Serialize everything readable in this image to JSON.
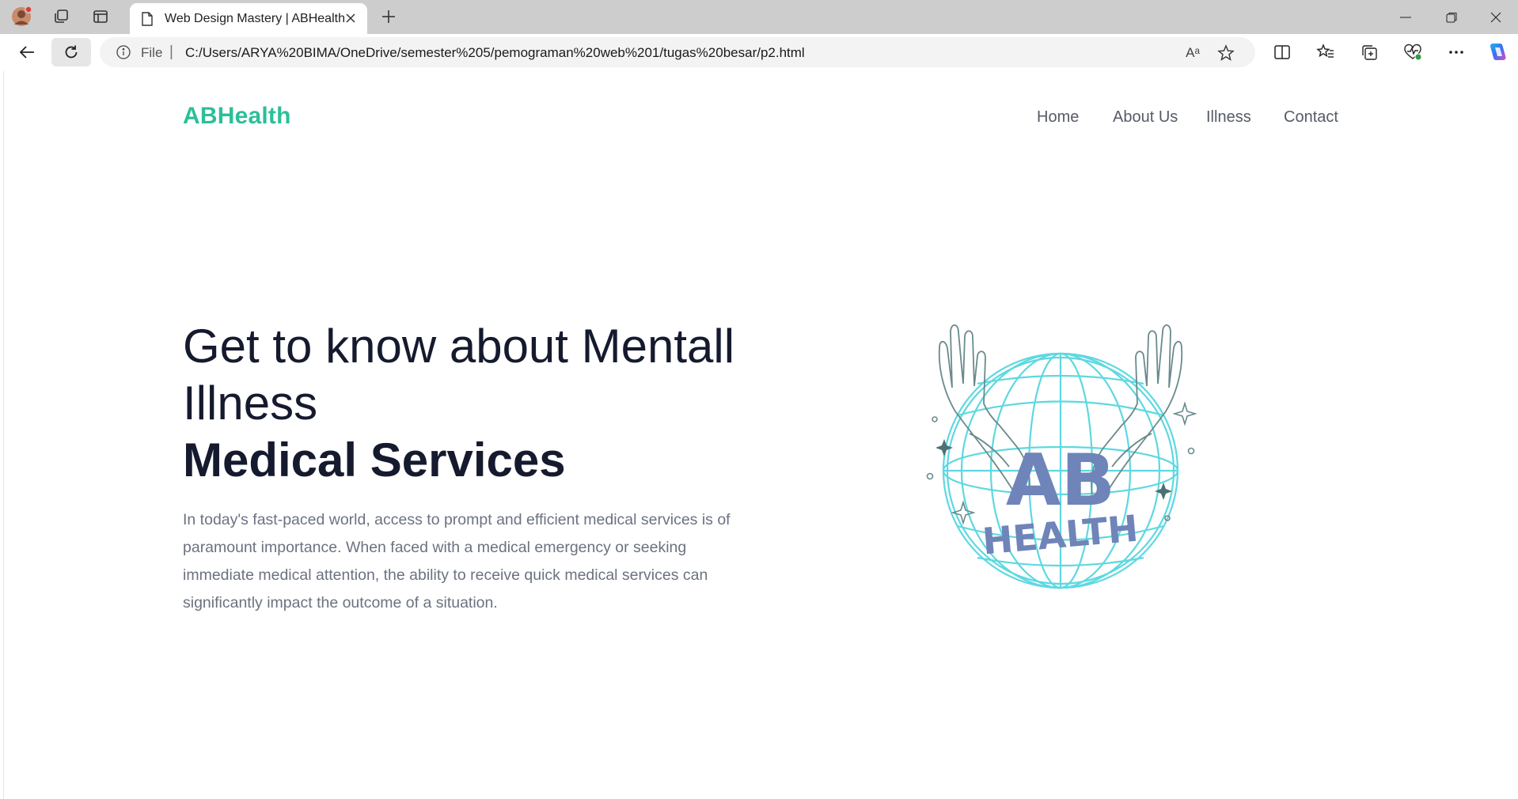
{
  "browser": {
    "tab_title": "Web Design Mastery | ABHealth",
    "address_scheme": "File",
    "address_url": "C:/Users/ARYA%20BIMA/OneDrive/semester%205/pemograman%20web%201/tugas%20besar/p2.html",
    "read_aloud_label": "Aᵃ"
  },
  "site": {
    "logo": "ABHealth",
    "nav": [
      "Home",
      "About Us",
      "Illness",
      "Contact"
    ]
  },
  "hero": {
    "title_line1": "Get to know about Mentall Illness",
    "title_line2": "Medical Services",
    "paragraph": "In today's fast-paced world, access to prompt and efficient medical services is of paramount importance. When faced with a medical emergency or seeking immediate medical attention, the ability to receive quick medical services can significantly impact the outcome of a situation.",
    "image_text_top": "AB",
    "image_text_bottom": "HEALTH"
  },
  "colors": {
    "brand": "#2cbf9a",
    "heading": "#151a2e",
    "body_text": "#6b7280",
    "globe": "#5ed8e0",
    "hands": "#6a8a8c",
    "logo_text": "#6f84b8"
  }
}
